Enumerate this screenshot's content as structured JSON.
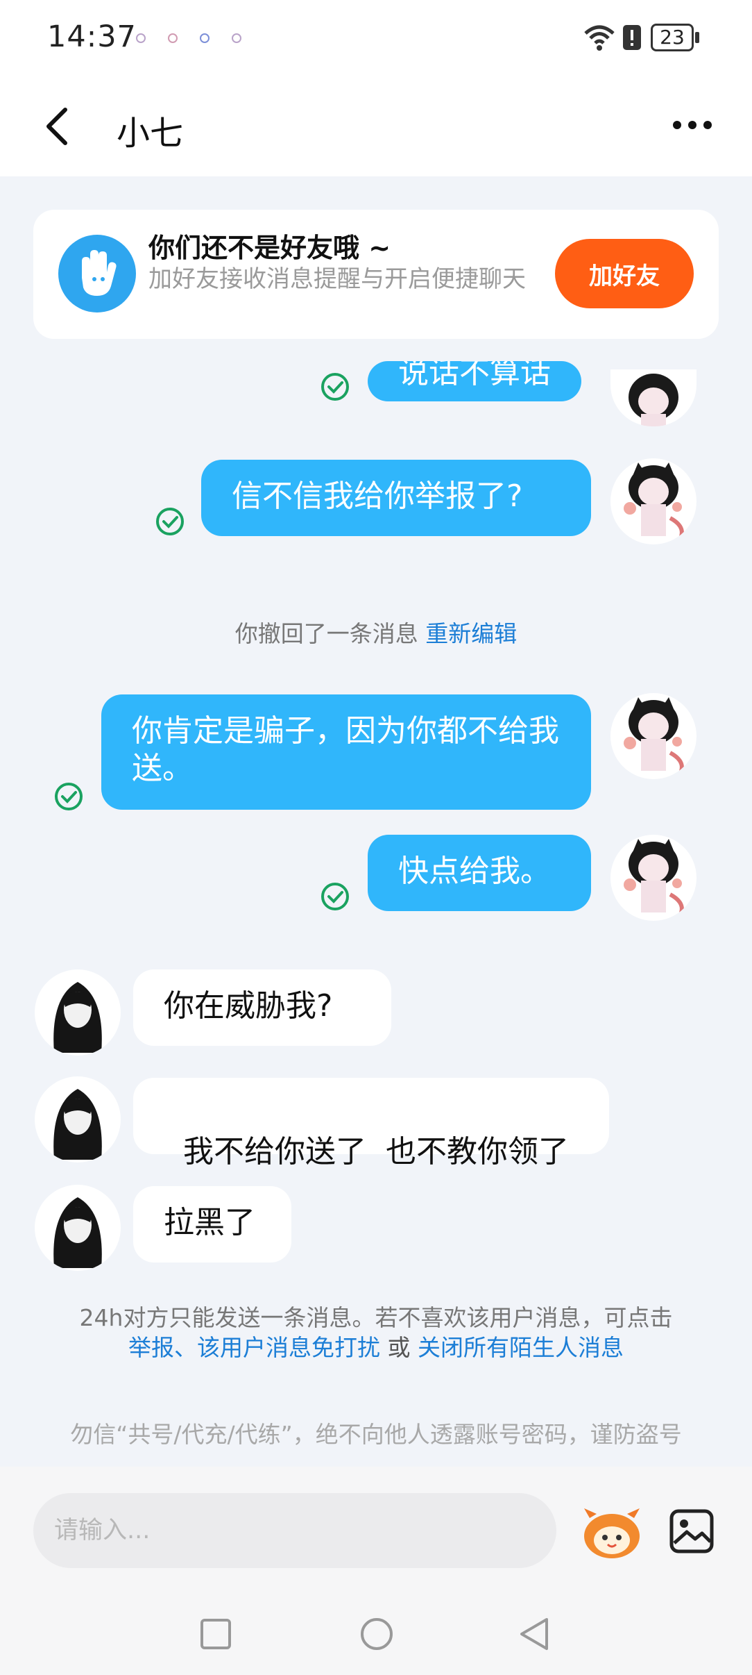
{
  "status_bar": {
    "time": "14:37",
    "battery": "23"
  },
  "header": {
    "title": "小七"
  },
  "banner": {
    "title": "你们还不是好友哦 ~",
    "subtitle": "加好友接收消息提醒与开启便捷聊天",
    "add_button": "加好友"
  },
  "messages": {
    "m0": "说话不算话",
    "m1": "信不信我给你举报了?",
    "recall_text": "你撤回了一条消息",
    "recall_link": "重新编辑",
    "m2": "你肯定是骗子，因为你都不给我送。",
    "m3": "快点给我。",
    "m4": "你在威胁我?",
    "m5": "我不给你送了  也不教你领了",
    "m6": "拉黑了"
  },
  "notice": {
    "text": "24h对方只能发送一条消息。若不喜欢该用户消息，可点击",
    "report": "举报",
    "sep": "、",
    "mute": "该用户消息免打扰",
    "or": " 或 ",
    "close_all": "关闭所有陌生人消息"
  },
  "warning": "勿信“共号/代充/代练”，绝不向他人透露账号密码，谨防盗号",
  "input": {
    "placeholder": "请输入..."
  },
  "colors": {
    "accent": "#30b6fb",
    "button": "#ff5e14",
    "link": "#1c7ed6",
    "check": "#1aa260"
  }
}
